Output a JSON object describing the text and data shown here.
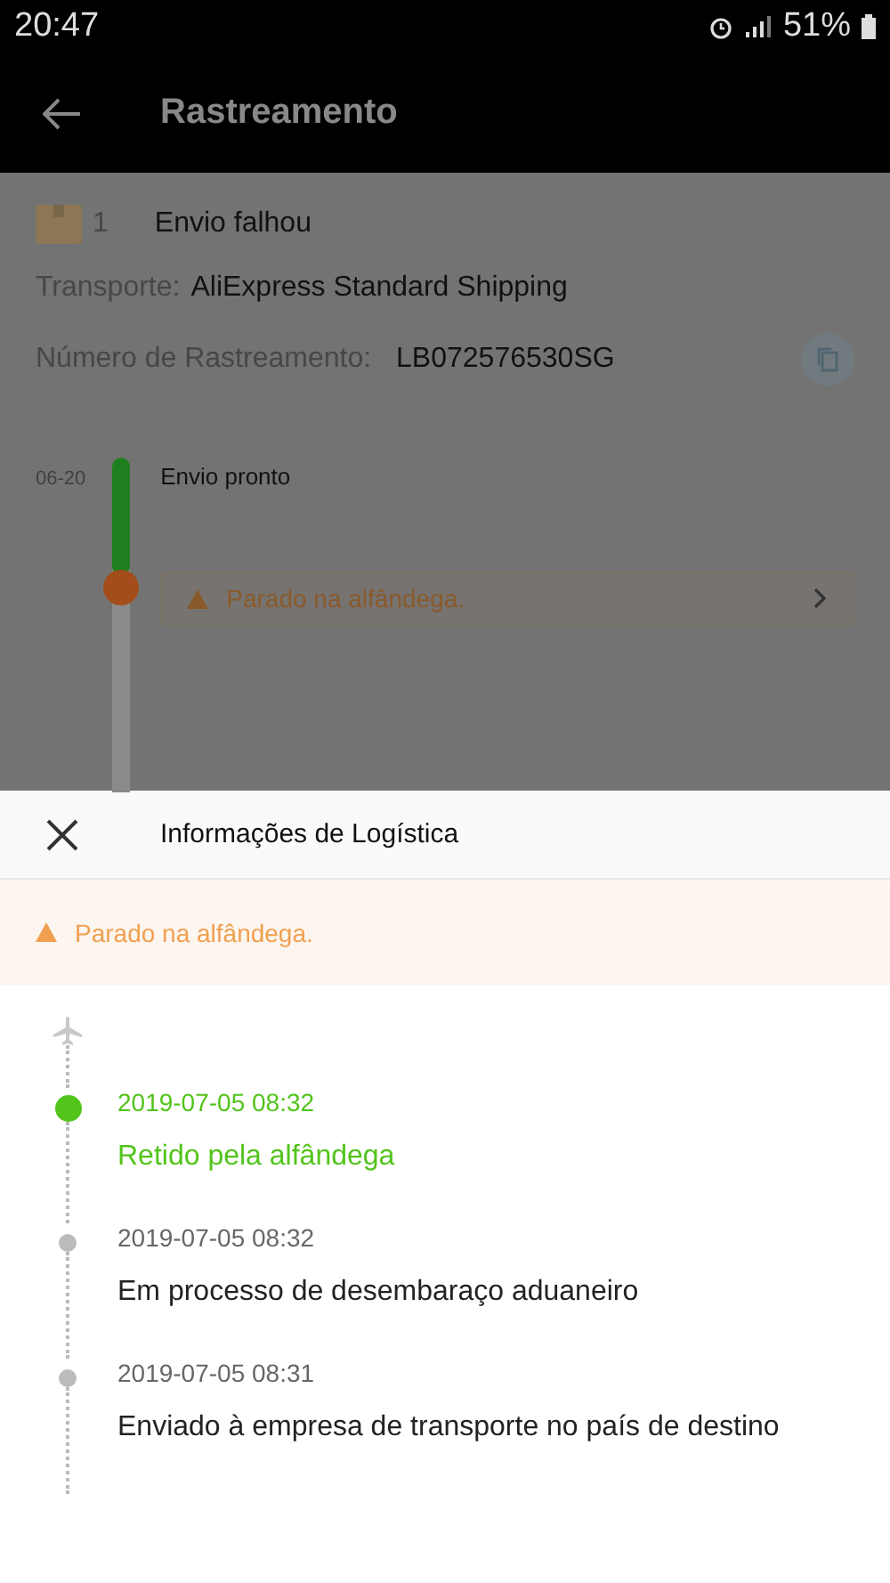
{
  "status_bar": {
    "time": "20:47",
    "battery": "51%"
  },
  "app_bar": {
    "title": "Rastreamento"
  },
  "package": {
    "count": "1",
    "status": "Envio falhou",
    "carrier_label": "Transporte:",
    "carrier": "AliExpress Standard Shipping",
    "tracking_label": "Número de Rastreamento:",
    "tracking_number": "LB072576530SG"
  },
  "timeline": {
    "date": "06-20",
    "event": "Envio pronto",
    "alert": "Parado na alfândega."
  },
  "sheet": {
    "title": "Informações de Logística",
    "alert": "Parado na alfândega.",
    "events": [
      {
        "time": "2019-07-05 08:32",
        "text": "Retido pela alfândega",
        "current": true
      },
      {
        "time": "2019-07-05 08:32",
        "text": "Em processo de desembaraço aduaneiro",
        "current": false
      },
      {
        "time": "2019-07-05 08:31",
        "text": "Enviado à empresa de transporte no país de destino",
        "current": false
      }
    ]
  }
}
